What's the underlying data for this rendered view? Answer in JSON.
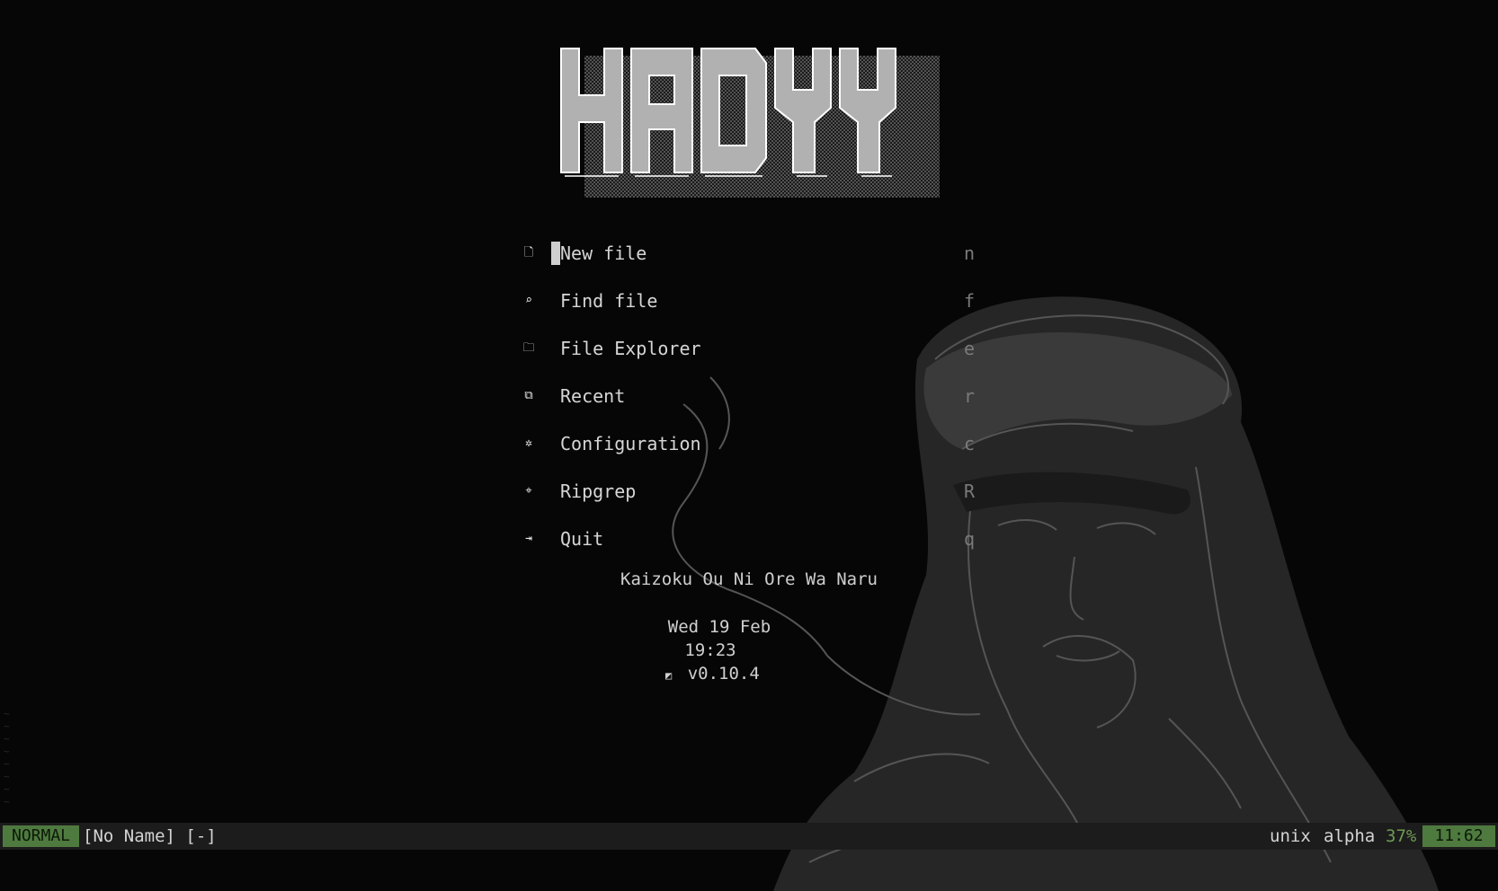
{
  "header": {
    "logo_text": "HADYY"
  },
  "menu": [
    {
      "icon": "new-file-icon",
      "glyph": "🗋",
      "label": "New file",
      "key": "n"
    },
    {
      "icon": "find-file-icon",
      "glyph": "⌕",
      "label": "Find file",
      "key": "f"
    },
    {
      "icon": "folder-icon",
      "glyph": "🗀",
      "label": "File Explorer",
      "key": "e"
    },
    {
      "icon": "recent-icon",
      "glyph": "⧉",
      "label": "Recent",
      "key": "r"
    },
    {
      "icon": "gear-icon",
      "glyph": "✲",
      "label": "Configuration",
      "key": "c"
    },
    {
      "icon": "ripgrep-icon",
      "glyph": "⌖",
      "label": "Ripgrep",
      "key": "R"
    },
    {
      "icon": "quit-icon",
      "glyph": "⇥",
      "label": "Quit",
      "key": "q"
    }
  ],
  "footer": {
    "quote": "Kaizoku Ou Ni Ore Wa Naru",
    "date": "Wed 19 Feb",
    "time": "19:23",
    "version_icon": "neovim-icon",
    "version": "v0.10.4"
  },
  "statusline": {
    "mode": "NORMAL",
    "file": "[No Name] [-]",
    "format": "unix",
    "theme": "alpha",
    "percent": "37%",
    "position": "11:62"
  },
  "colors": {
    "background": "#060606",
    "accent_green": "#4f7a3f",
    "text": "#cfcfcf",
    "muted": "#7a7a7a"
  }
}
